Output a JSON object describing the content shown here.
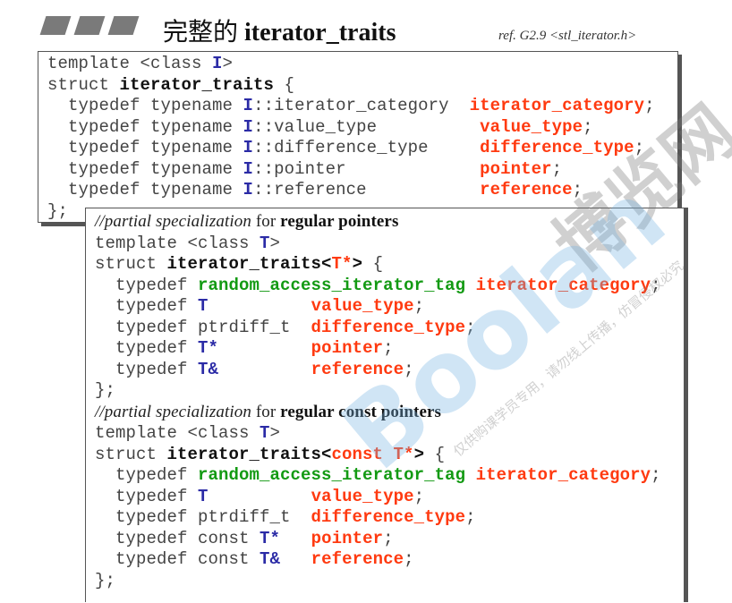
{
  "header": {
    "title_cjk": "完整的",
    "title_code": "iterator_traits",
    "reference": "ref. G2.9  <stl_iterator.h>"
  },
  "colors": {
    "type_param": "#2b2ba6",
    "typedef_name": "#ff3a10",
    "tag": "#139a13"
  },
  "watermark": {
    "site": "博览网",
    "brand": "Boolan",
    "notice": "仅供购课学员专用，请勿线上传播，仿冒侵权必究"
  },
  "primary_template": [
    [
      [
        "n",
        "template <class "
      ],
      [
        "b",
        "I"
      ],
      [
        "n",
        ">"
      ]
    ],
    [
      [
        "n",
        "struct "
      ],
      [
        "k",
        "iterator_traits"
      ],
      [
        "n",
        " {"
      ]
    ],
    [
      [
        "n",
        "  typedef typename "
      ],
      [
        "b",
        "I"
      ],
      [
        "n",
        "::iterator_category  "
      ],
      [
        "r",
        "iterator_category"
      ],
      [
        "n",
        ";"
      ]
    ],
    [
      [
        "n",
        "  typedef typename "
      ],
      [
        "b",
        "I"
      ],
      [
        "n",
        "::value_type          "
      ],
      [
        "r",
        "value_type"
      ],
      [
        "n",
        ";"
      ]
    ],
    [
      [
        "n",
        "  typedef typename "
      ],
      [
        "b",
        "I"
      ],
      [
        "n",
        "::difference_type     "
      ],
      [
        "r",
        "difference_type"
      ],
      [
        "n",
        ";"
      ]
    ],
    [
      [
        "n",
        "  typedef typename "
      ],
      [
        "b",
        "I"
      ],
      [
        "n",
        "::pointer             "
      ],
      [
        "r",
        "pointer"
      ],
      [
        "n",
        ";"
      ]
    ],
    [
      [
        "n",
        "  typedef typename "
      ],
      [
        "b",
        "I"
      ],
      [
        "n",
        "::reference           "
      ],
      [
        "r",
        "reference"
      ],
      [
        "n",
        ";"
      ]
    ],
    [
      [
        "n",
        "};"
      ]
    ]
  ],
  "specializations": [
    [
      [
        "ci",
        "//partial specialization"
      ],
      [
        "cn",
        " for "
      ],
      [
        "cb",
        "regular pointers"
      ]
    ],
    [
      [
        "n",
        "template <class "
      ],
      [
        "b",
        "T"
      ],
      [
        "n",
        ">"
      ]
    ],
    [
      [
        "n",
        "struct "
      ],
      [
        "k",
        "iterator_traits<"
      ],
      [
        "r",
        "T*"
      ],
      [
        "k",
        ">"
      ],
      [
        "n",
        " {"
      ]
    ],
    [
      [
        "n",
        "  typedef "
      ],
      [
        "g",
        "random_access_iterator_tag"
      ],
      [
        "n",
        " "
      ],
      [
        "r",
        "iterator_category"
      ],
      [
        "n",
        ";"
      ]
    ],
    [
      [
        "n",
        "  typedef "
      ],
      [
        "b",
        "T"
      ],
      [
        "n",
        "          "
      ],
      [
        "r",
        "value_type"
      ],
      [
        "n",
        ";"
      ]
    ],
    [
      [
        "n",
        "  typedef ptrdiff_t  "
      ],
      [
        "r",
        "difference_type"
      ],
      [
        "n",
        ";"
      ]
    ],
    [
      [
        "n",
        "  typedef "
      ],
      [
        "b",
        "T*"
      ],
      [
        "n",
        "         "
      ],
      [
        "r",
        "pointer"
      ],
      [
        "n",
        ";"
      ]
    ],
    [
      [
        "n",
        "  typedef "
      ],
      [
        "b",
        "T&"
      ],
      [
        "n",
        "         "
      ],
      [
        "r",
        "reference"
      ],
      [
        "n",
        ";"
      ]
    ],
    [
      [
        "n",
        "};"
      ]
    ],
    [
      [
        "ci",
        "//partial specialization"
      ],
      [
        "cn",
        " for "
      ],
      [
        "cb",
        "regular const pointers"
      ]
    ],
    [
      [
        "n",
        "template <class "
      ],
      [
        "b",
        "T"
      ],
      [
        "n",
        ">"
      ]
    ],
    [
      [
        "n",
        "struct "
      ],
      [
        "k",
        "iterator_traits<"
      ],
      [
        "r",
        "const T*"
      ],
      [
        "k",
        ">"
      ],
      [
        "n",
        " {"
      ]
    ],
    [
      [
        "n",
        "  typedef "
      ],
      [
        "g",
        "random_access_iterator_tag"
      ],
      [
        "n",
        " "
      ],
      [
        "r",
        "iterator_category"
      ],
      [
        "n",
        ";"
      ]
    ],
    [
      [
        "n",
        "  typedef "
      ],
      [
        "b",
        "T"
      ],
      [
        "n",
        "          "
      ],
      [
        "r",
        "value_type"
      ],
      [
        "n",
        ";"
      ]
    ],
    [
      [
        "n",
        "  typedef ptrdiff_t  "
      ],
      [
        "r",
        "difference_type"
      ],
      [
        "n",
        ";"
      ]
    ],
    [
      [
        "n",
        "  typedef const "
      ],
      [
        "b",
        "T*"
      ],
      [
        "n",
        "   "
      ],
      [
        "r",
        "pointer"
      ],
      [
        "n",
        ";"
      ]
    ],
    [
      [
        "n",
        "  typedef const "
      ],
      [
        "b",
        "T&"
      ],
      [
        "n",
        "   "
      ],
      [
        "r",
        "reference"
      ],
      [
        "n",
        ";"
      ]
    ],
    [
      [
        "n",
        "};"
      ]
    ]
  ]
}
